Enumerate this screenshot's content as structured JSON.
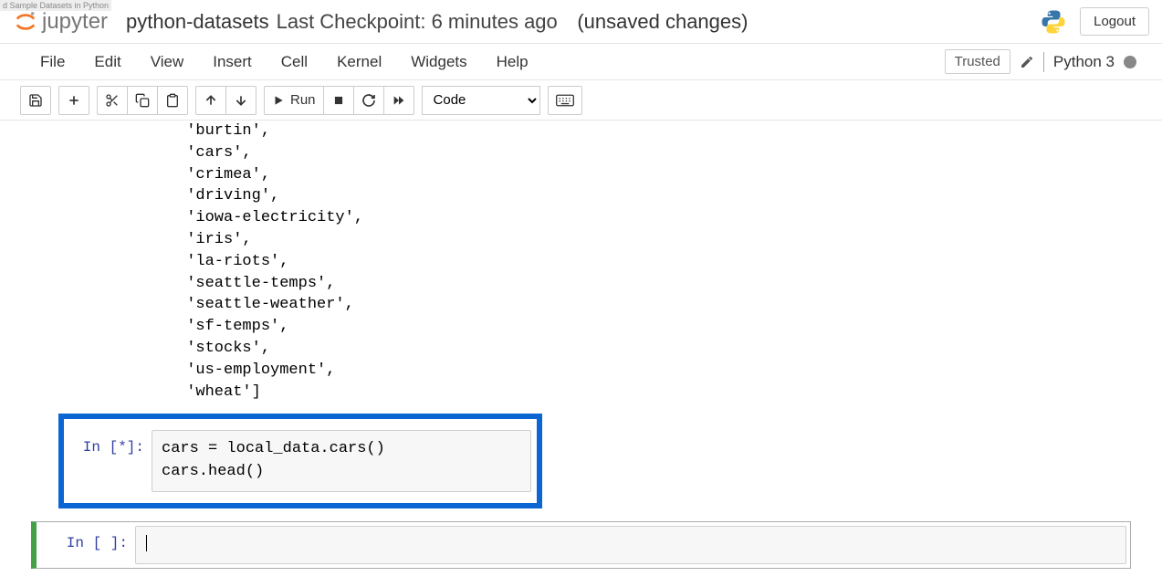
{
  "browser_tab": "d Sample Datasets in Python",
  "header": {
    "logo_text": "jupyter",
    "title": "python-datasets",
    "checkpoint": "Last Checkpoint: 6 minutes ago",
    "unsaved": "(unsaved changes)",
    "logout": "Logout"
  },
  "menu": {
    "items": [
      "File",
      "Edit",
      "View",
      "Insert",
      "Cell",
      "Kernel",
      "Widgets",
      "Help"
    ],
    "trusted": "Trusted",
    "kernel_name": "Python 3"
  },
  "toolbar": {
    "run_label": "Run",
    "celltype": "Code"
  },
  "notebook": {
    "output_text": " 'burtin',\n 'cars',\n 'crimea',\n 'driving',\n 'iowa-electricity',\n 'iris',\n 'la-riots',\n 'seattle-temps',\n 'seattle-weather',\n 'sf-temps',\n 'stocks',\n 'us-employment',\n 'wheat']",
    "cells": [
      {
        "prompt": "In [*]:",
        "code": "cars = local_data.cars()\ncars.head()"
      },
      {
        "prompt": "In [ ]:",
        "code": ""
      }
    ]
  }
}
